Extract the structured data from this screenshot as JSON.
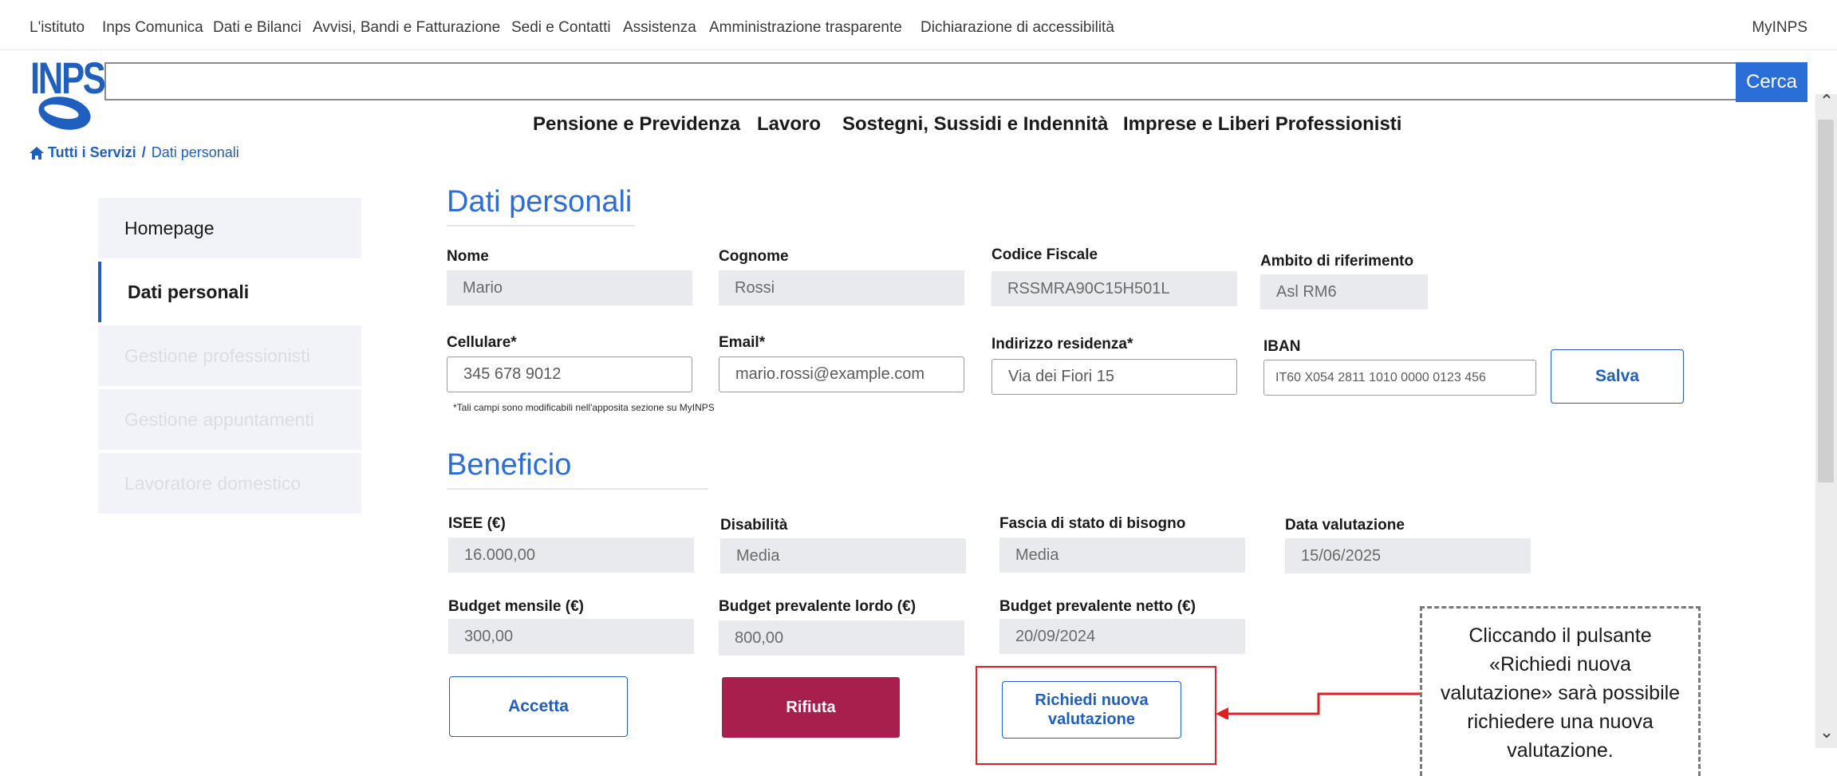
{
  "topnav": {
    "links": [
      "L'istituto",
      "Inps Comunica",
      "Dati e Bilanci",
      "Avvisi, Bandi e Fatturazione",
      "Sedi e Contatti",
      "Assistenza",
      "Amministrazione trasparente",
      "Dichiarazione di accessibilità"
    ],
    "myinps": "MyINPS"
  },
  "logo": {
    "text": "INPS"
  },
  "search": {
    "button": "Cerca",
    "value": ""
  },
  "mainnav": [
    "Pensione e Previdenza",
    "Lavoro",
    "Sostegni, Sussidi e Indennità",
    "Imprese e Liberi Professionisti"
  ],
  "breadcrumb": {
    "home": "Tutti i Servizi",
    "sep": "/",
    "current": "Dati personali"
  },
  "sidebar": {
    "items": [
      {
        "label": "Homepage",
        "state": "normal"
      },
      {
        "label": "Dati personali",
        "state": "active"
      },
      {
        "label": "Gestione professionisti",
        "state": "disabled"
      },
      {
        "label": "Gestione appuntamenti",
        "state": "disabled"
      },
      {
        "label": "Lavoratore domestico",
        "state": "disabled"
      }
    ]
  },
  "personal": {
    "title": "Dati personali",
    "nome": {
      "label": "Nome",
      "value": "Mario"
    },
    "cognome": {
      "label": "Cognome",
      "value": "Rossi"
    },
    "cf": {
      "label": "Codice Fiscale",
      "value": "RSSMRA90C15H501L"
    },
    "ambito": {
      "label": "Ambito di riferimento",
      "value": "Asl RM6"
    },
    "cellulare": {
      "label": "Cellulare*",
      "value": "345 678 9012"
    },
    "email": {
      "label": "Email*",
      "value": "mario.rossi@example.com"
    },
    "indirizzo": {
      "label": "Indirizzo residenza*",
      "value": "Via dei Fiori 15"
    },
    "iban": {
      "label": "IBAN",
      "value": "IT60 X054 2811 1010 0000 0123 456"
    },
    "save": "Salva",
    "note": "*Tali campi sono modificabili nell'apposita sezione su MyINPS"
  },
  "benefit": {
    "title": "Beneficio",
    "isee": {
      "label": "ISEE (€)",
      "value": "16.000,00"
    },
    "disabilita": {
      "label": "Disabilità",
      "value": "Media"
    },
    "fascia": {
      "label": "Fascia di stato di bisogno",
      "value": "Media"
    },
    "data": {
      "label": "Data valutazione",
      "value": "15/06/2025"
    },
    "budget_mensile": {
      "label": "Budget mensile (€)",
      "value": "300,00"
    },
    "budget_lordo": {
      "label": "Budget prevalente lordo  (€)",
      "value": "800,00"
    },
    "budget_netto": {
      "label": "Budget prevalente netto (€)",
      "value": "20/09/2024"
    },
    "accept": "Accetta",
    "reject": "Rifiuta",
    "request_line1": "Richiedi nuova",
    "request_line2": "valutazione"
  },
  "callout": {
    "text": "Cliccando il pulsante «Richiedi nuova valutazione» sarà possibile richiedere una nuova valutazione."
  },
  "colors": {
    "primary": "#1f5fbf",
    "danger": "#a81e4c",
    "highlight": "#e02020"
  }
}
